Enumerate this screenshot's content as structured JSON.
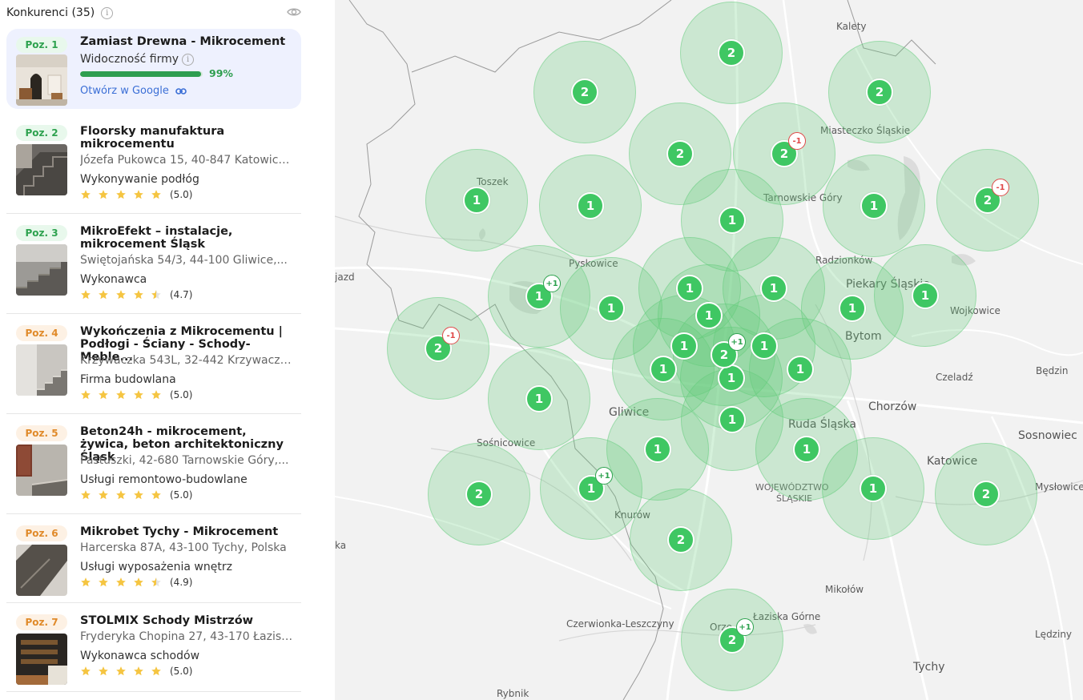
{
  "sidebar": {
    "title": "Konkurenci (35)",
    "cards": [
      {
        "pos": "Poz. 1",
        "name": "Zamiast Drewna - Mikrocement",
        "visibility_label": "Widoczność firmy",
        "visibility_percent": "99%",
        "visibility_value": 99,
        "link_label": "Otwórz w Google"
      },
      {
        "pos": "Poz. 2",
        "name": "Floorsky manufaktura mikrocementu",
        "address": "Józefa Pukowca 15, 40-847 Katowice...",
        "category": "Wykonywanie podłóg",
        "rating": "(5.0)",
        "stars": 5
      },
      {
        "pos": "Poz. 3",
        "name": "MikroEfekt – instalacje, mikrocement Śląsk",
        "address": "Świętojańska 54/3, 44-100 Gliwice,...",
        "category": "Wykonawca",
        "rating": "(4.7)",
        "stars": 4.5
      },
      {
        "pos": "Poz. 4",
        "name": "Wykończenia z Mikrocementu | Podłogi - Ściany - Schody- Meble...",
        "address": "Krzywaczka 543L, 32-442 Krzywaczk...",
        "category": "Firma budowlana",
        "rating": "(5.0)",
        "stars": 5
      },
      {
        "pos": "Poz. 5",
        "name": "Beton24h - mikrocement, żywica, beton architektoniczny Śląsk",
        "address": "Pastuszki, 42-680 Tarnowskie Góry,...",
        "category": "Usługi remontowo-budowlane",
        "rating": "(5.0)",
        "stars": 5
      },
      {
        "pos": "Poz. 6",
        "name": "Mikrobet Tychy - Mikrocement",
        "address": "Harcerska 87A, 43-100 Tychy, Polska",
        "category": "Usługi wyposażenia wnętrz",
        "rating": "(4.9)",
        "stars": 4.5
      },
      {
        "pos": "Poz. 7",
        "name": "STOLMIX Schody Mistrzów",
        "address": "Fryderyka Chopina 27, 43-170 Łazisk...",
        "category": "Wykonawca schodów",
        "rating": "(5.0)",
        "stars": 5
      }
    ]
  },
  "map": {
    "places": [
      {
        "id": "kalety",
        "label": "Kalety"
      },
      {
        "id": "miasteczko",
        "label": "Miasteczko Śląskie"
      },
      {
        "id": "toszek",
        "label": "Toszek"
      },
      {
        "id": "tarnowskie",
        "label": "Tarnowskie Góry"
      },
      {
        "id": "pyskowice",
        "label": "Pyskowice"
      },
      {
        "id": "radzionkow",
        "label": "Radzionków"
      },
      {
        "id": "piekary",
        "label": "Piekary Śląskie"
      },
      {
        "id": "wojkowice",
        "label": "Wojkowice"
      },
      {
        "id": "jazd",
        "label": "jazd"
      },
      {
        "id": "bytom",
        "label": "Bytom"
      },
      {
        "id": "czeladz",
        "label": "Czeladź"
      },
      {
        "id": "bedzin",
        "label": "Będzin"
      },
      {
        "id": "chorzow",
        "label": "Chorzów"
      },
      {
        "id": "gliwice",
        "label": "Gliwice"
      },
      {
        "id": "ruda",
        "label": "Ruda Śląska"
      },
      {
        "id": "sosnicowice",
        "label": "Sośnicowice"
      },
      {
        "id": "sosnowiec",
        "label": "Sosnowiec"
      },
      {
        "id": "katowice",
        "label": "Katowice"
      },
      {
        "id": "myslowice",
        "label": "Mysłowice"
      },
      {
        "id": "woj1",
        "label": "WOJEWÓDZTWO"
      },
      {
        "id": "woj2",
        "label": "ŚLĄSKIE"
      },
      {
        "id": "knurow",
        "label": "Knurów"
      },
      {
        "id": "ka",
        "label": "ka"
      },
      {
        "id": "mikolow",
        "label": "Mikołów"
      },
      {
        "id": "czerwionka",
        "label": "Czerwionka-Leszczyny"
      },
      {
        "id": "lazisk",
        "label": "Łaziska Górne"
      },
      {
        "id": "orzesze",
        "label": "Orze"
      },
      {
        "id": "ledziny",
        "label": "Lędziny"
      },
      {
        "id": "tychy",
        "label": "Tychy"
      },
      {
        "id": "rybnik",
        "label": "Rybnik"
      }
    ],
    "pins": [
      {
        "label": "2"
      },
      {
        "label": "2"
      },
      {
        "label": "2"
      },
      {
        "label": "2"
      },
      {
        "label": "2",
        "delta": "-1"
      },
      {
        "label": "1"
      },
      {
        "label": "1"
      },
      {
        "label": "1"
      },
      {
        "label": "1"
      },
      {
        "label": "2",
        "delta": "-1"
      },
      {
        "label": "1",
        "delta": "+1"
      },
      {
        "label": "1"
      },
      {
        "label": "1"
      },
      {
        "label": "1"
      },
      {
        "label": "1"
      },
      {
        "label": "1"
      },
      {
        "label": "2",
        "delta": "-1"
      },
      {
        "label": "1"
      },
      {
        "label": "1"
      },
      {
        "label": "1"
      },
      {
        "label": "1"
      },
      {
        "label": "1"
      },
      {
        "label": "1"
      },
      {
        "label": "1"
      },
      {
        "label": "1"
      },
      {
        "label": "1"
      },
      {
        "label": "1"
      },
      {
        "label": "2"
      },
      {
        "label": "1",
        "delta": "+1"
      },
      {
        "label": "1"
      },
      {
        "label": "2"
      },
      {
        "label": "2"
      },
      {
        "label": "2",
        "delta": "+1"
      },
      {
        "label": "2",
        "delta": "+1"
      }
    ]
  },
  "colors": {
    "pin": "#3fc763",
    "circle": "#62cc7a",
    "delta_up": "#2ea24f",
    "delta_down": "#e04848",
    "link": "#3b6fd6",
    "active_card": "#eef1fe"
  }
}
